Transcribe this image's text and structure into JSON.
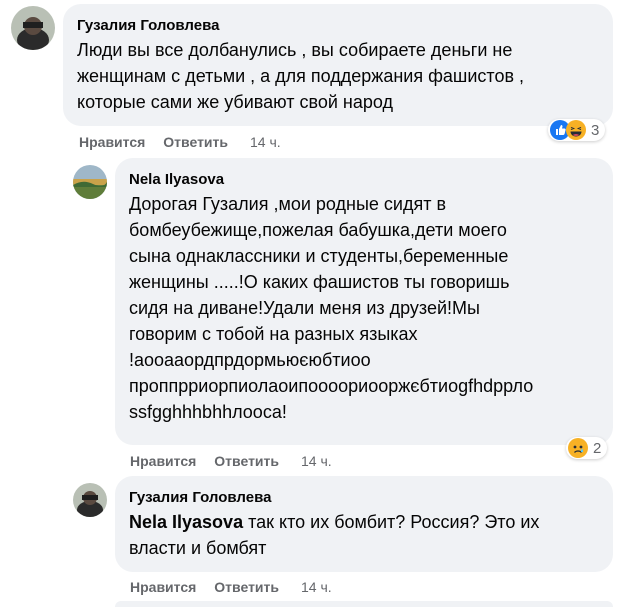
{
  "comments": [
    {
      "author": "Гузалия Головлева",
      "text": "Люди вы все долбанулись , вы собираете деньги не\nженщинам с детьми , а для поддержания фашистов ,\nкоторые сами же убивают свой народ",
      "like_label": "Нравится",
      "reply_label": "Ответить",
      "time": "14 ч.",
      "reaction_icons": [
        "like-reaction-icon",
        "haha-reaction-icon"
      ],
      "reaction_count": "3"
    },
    {
      "author": "Nela Ilyasova",
      "text": "Дорогая Гузалия ,мои родные сидят в\nбомбеубежище,пожелая бабушка,дети моего\nсына однаклассники и студенты,беременные\nженщины .....!О каких фашистов ты говоришь\nсидя на диване!Удали меня из друзей!Мы\nговорим с тобой на разных языках\n!аооааордпрдормьюєюбтиоо\nпроппрриорпиолаоипоооориоорж​єбтиоgfhdpрло\nssfgghhhbhhлооса!",
      "like_label": "Нравится",
      "reply_label": "Ответить",
      "time": "14 ч.",
      "reaction_icons": [
        "sad-reaction-icon"
      ],
      "reaction_count": "2"
    },
    {
      "author": "Гузалия Головлева",
      "mention": "Nela Ilyasova",
      "text": " так кто их бомбит? Россия? Это их\nвласти и бомбят",
      "like_label": "Нравится",
      "reply_label": "Ответить",
      "time": "14 ч."
    }
  ],
  "colors": {
    "bubble_bg": "#f0f2f5",
    "meta_text": "#65676b",
    "like_blue": "#1877f2",
    "haha_yellow": "#f7b125"
  }
}
